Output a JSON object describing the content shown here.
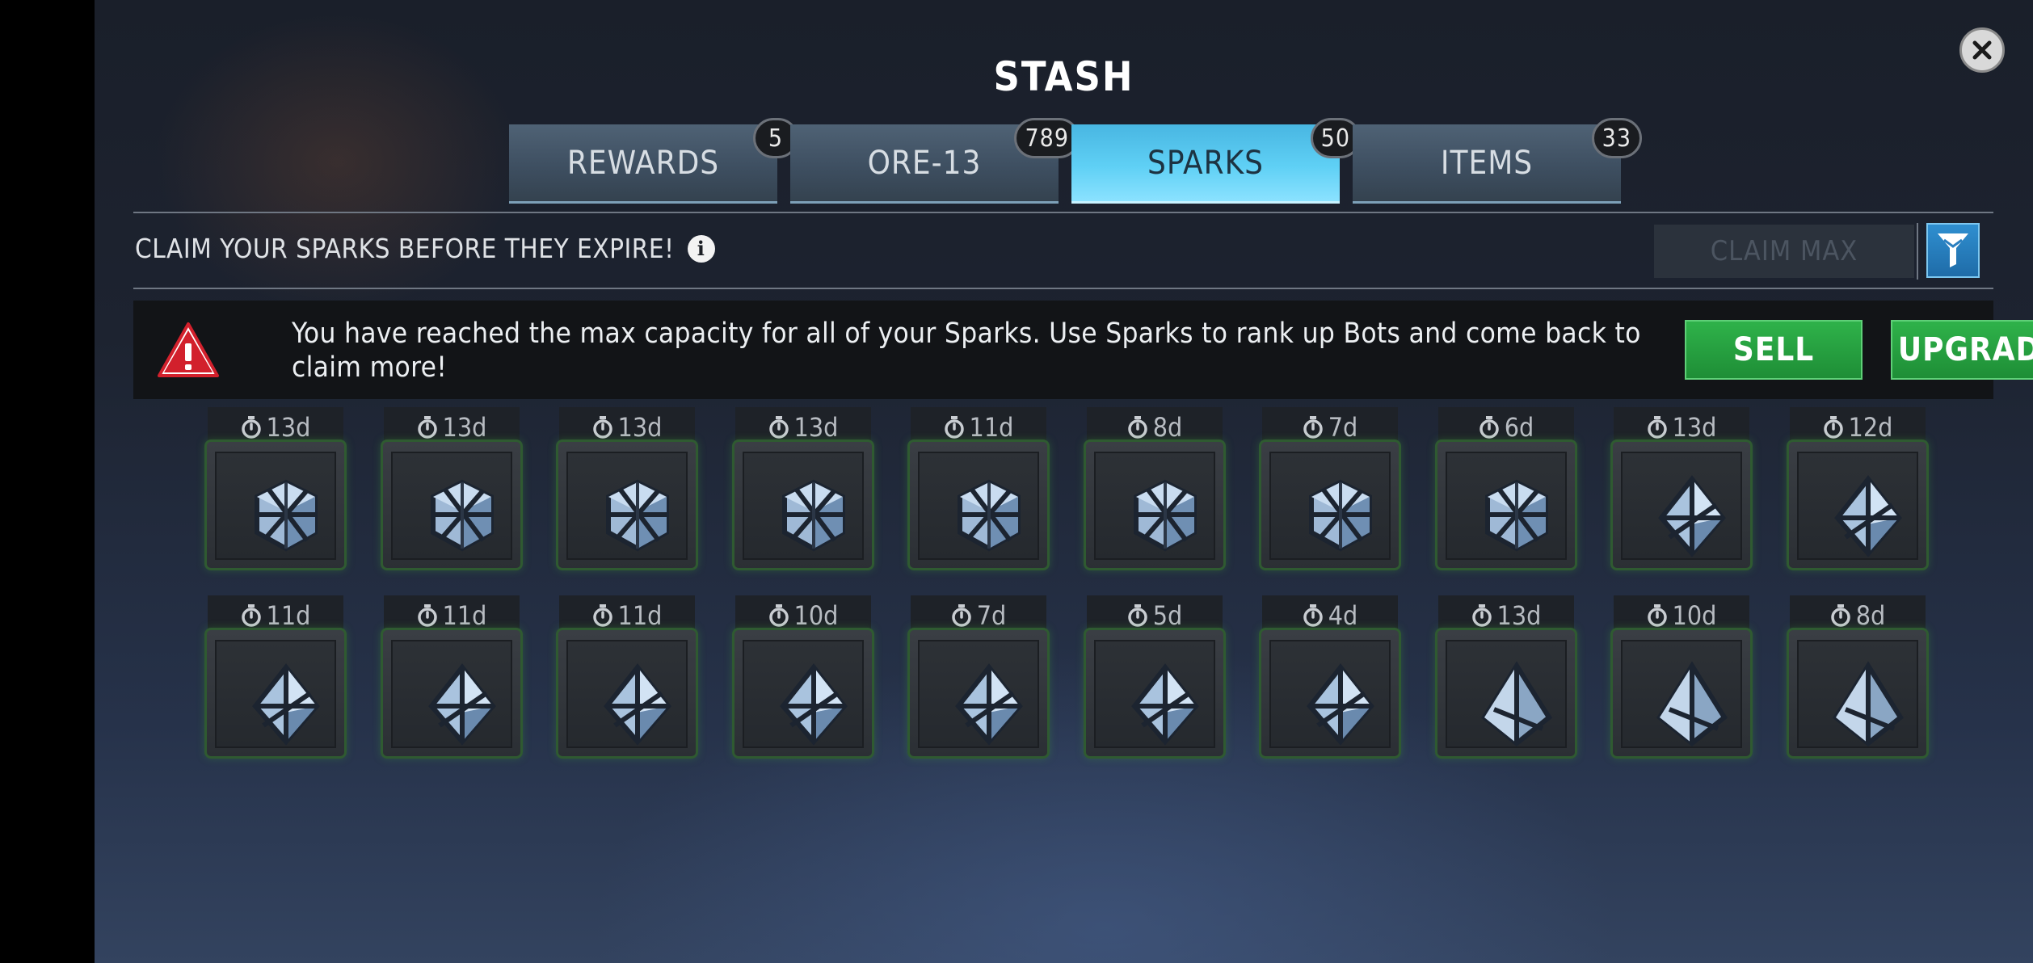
{
  "header": {
    "title": "STASH",
    "close_icon": "close-icon"
  },
  "tabs": [
    {
      "label": "REWARDS",
      "count": "5",
      "active": false
    },
    {
      "label": "ORE-13",
      "count": "789",
      "active": false
    },
    {
      "label": "SPARKS",
      "count": "50",
      "active": true
    },
    {
      "label": "ITEMS",
      "count": "33",
      "active": false
    }
  ],
  "toolbar": {
    "claim_text": "CLAIM YOUR SPARKS BEFORE THEY EXPIRE!",
    "info_icon": "info-icon",
    "claim_max_label": "CLAIM MAX",
    "claim_max_enabled": false,
    "filter_icon": "filter-icon"
  },
  "alert": {
    "icon": "warning-icon",
    "message": "You have reached the max capacity for all of your Sparks. Use Sparks to rank up Bots and come back to claim more!",
    "sell_label": "SELL",
    "upgrade_label": "UPGRADE"
  },
  "sparks": [
    {
      "timer": "13d",
      "shape": "cube"
    },
    {
      "timer": "13d",
      "shape": "cube"
    },
    {
      "timer": "13d",
      "shape": "cube"
    },
    {
      "timer": "13d",
      "shape": "cube"
    },
    {
      "timer": "11d",
      "shape": "cube"
    },
    {
      "timer": "8d",
      "shape": "cube"
    },
    {
      "timer": "7d",
      "shape": "cube"
    },
    {
      "timer": "6d",
      "shape": "cube"
    },
    {
      "timer": "13d",
      "shape": "octahedron"
    },
    {
      "timer": "12d",
      "shape": "octahedron"
    },
    {
      "timer": "11d",
      "shape": "octahedron"
    },
    {
      "timer": "11d",
      "shape": "octahedron"
    },
    {
      "timer": "11d",
      "shape": "octahedron"
    },
    {
      "timer": "10d",
      "shape": "octahedron"
    },
    {
      "timer": "7d",
      "shape": "octahedron"
    },
    {
      "timer": "5d",
      "shape": "octahedron"
    },
    {
      "timer": "4d",
      "shape": "octahedron"
    },
    {
      "timer": "13d",
      "shape": "tetrahedron"
    },
    {
      "timer": "10d",
      "shape": "tetrahedron"
    },
    {
      "timer": "8d",
      "shape": "tetrahedron"
    }
  ],
  "colors": {
    "active_tab": "#5fd0f5",
    "green_button": "#1e8e36",
    "card_border": "#2f5a31",
    "warning": "#d2202c"
  }
}
